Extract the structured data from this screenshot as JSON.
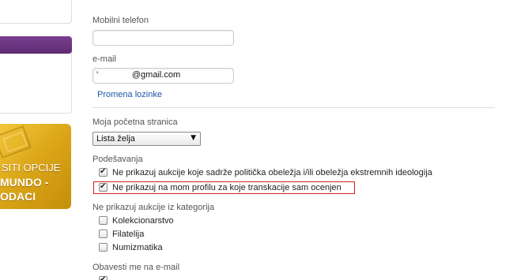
{
  "sidebar": {
    "promo_lines": [
      "SITI OPCIJE",
      "MUNDO -",
      "ODACI"
    ]
  },
  "form": {
    "mobile_label": "Mobilni telefon",
    "mobile_value": "",
    "email_label": "e-mail",
    "email_value": "'              @gmail.com",
    "change_password_link": "Promena lozinke",
    "homepage_label": "Moja početna stranica",
    "homepage_selected": "Lista želja",
    "settings_label": "Podešavanja",
    "settings_options": [
      {
        "label": "Ne prikazuj aukcije koje sadrže politička obeležja i/ili obeležja ekstremnih ideologija",
        "checked": true
      },
      {
        "label": "Ne prikazuj na mom profilu za koje transkacije sam ocenjen",
        "checked": true
      }
    ],
    "hide_categories_label": "Ne prikazuj aukcije iz kategorija",
    "categories": [
      {
        "label": "Kolekcionarstvo",
        "checked": false
      },
      {
        "label": "Filatelija",
        "checked": false
      },
      {
        "label": "Numizmatika",
        "checked": false
      }
    ],
    "notify_label": "Obavesti me na e-mail"
  },
  "colors": {
    "link": "#1a56a8",
    "highlight_border": "#cc2222",
    "purple_bar": "#6a3380",
    "promo_gold": "#e0ad1f"
  }
}
